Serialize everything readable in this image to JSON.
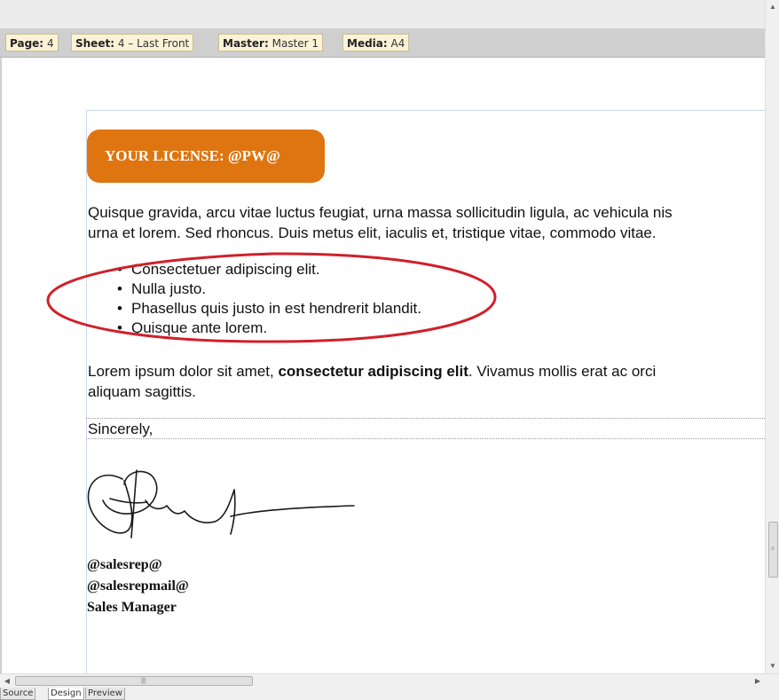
{
  "info_bar": {
    "page": {
      "label": "Page:",
      "value": "4"
    },
    "sheet": {
      "label": "Sheet:",
      "value": "4 – Last Front"
    },
    "master": {
      "label": "Master:",
      "value": "Master 1"
    },
    "media": {
      "label": "Media:",
      "value": "A4"
    }
  },
  "document": {
    "license_badge": "YOUR LICENSE: @PW@",
    "intro_line1": "Quisque gravida, arcu vitae luctus feugiat, urna massa sollicitudin ligula, ac vehicula nis",
    "intro_line2": "urna et lorem. Sed rhoncus. Duis metus elit, iaculis et, tristique vitae, commodo vitae.",
    "bullets": [
      "Consectetuer adipiscing elit.",
      "Nulla justo.",
      "Phasellus quis justo in est hendrerit blandit.",
      "Quisque ante lorem."
    ],
    "body_pre": "Lorem ipsum dolor sit amet, ",
    "body_bold": "consectetur adipiscing elit",
    "body_post": ". Vivamus mollis erat ac orci",
    "body_line2": "aliquam sagittis.",
    "closing": "Sincerely,",
    "signature_lines": [
      "@salesrep@",
      "@salesrepmail@",
      "Sales Manager"
    ]
  },
  "colors": {
    "badge": "#de7510",
    "highlight_ellipse": "#d0202a"
  },
  "scrollbars": {
    "up_icon": "arrow-up-icon",
    "down_icon": "arrow-down-icon",
    "left_icon": "arrow-left-icon",
    "right_icon": "arrow-right-icon"
  },
  "tabs": [
    "Source",
    "Design",
    "Preview"
  ],
  "active_tab": "Design"
}
